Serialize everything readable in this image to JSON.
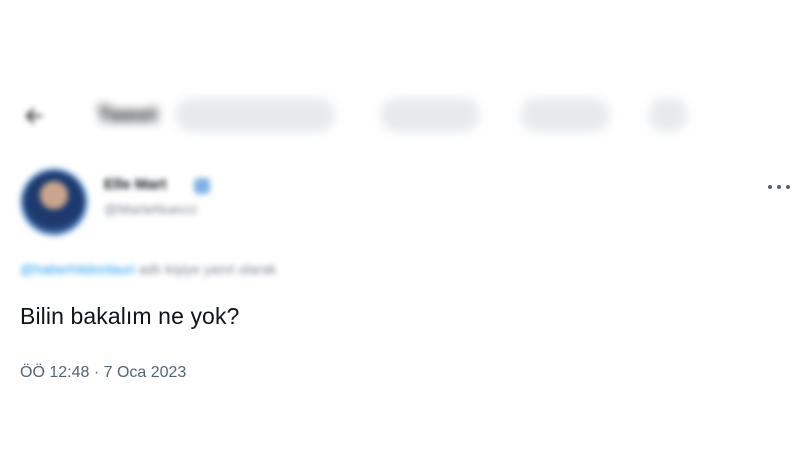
{
  "header": {
    "title": "Tweet",
    "back_icon": "arrow-left-icon"
  },
  "author": {
    "name": "Elle Mart",
    "handle": "@MarteNuecci",
    "verified": true
  },
  "reply": {
    "mention": "@haberhitdonlauri",
    "suffix": "adlı kişiye yanıt olarak"
  },
  "tweet": {
    "text": "Bilin bakalım ne yok?",
    "meta": "ÖÖ 12:48 · 7 Oca 2023"
  },
  "more_icon": "ellipsis-icon",
  "colors": {
    "text": "#0f1419",
    "secondary": "#536471",
    "link": "#1d9bf0"
  }
}
